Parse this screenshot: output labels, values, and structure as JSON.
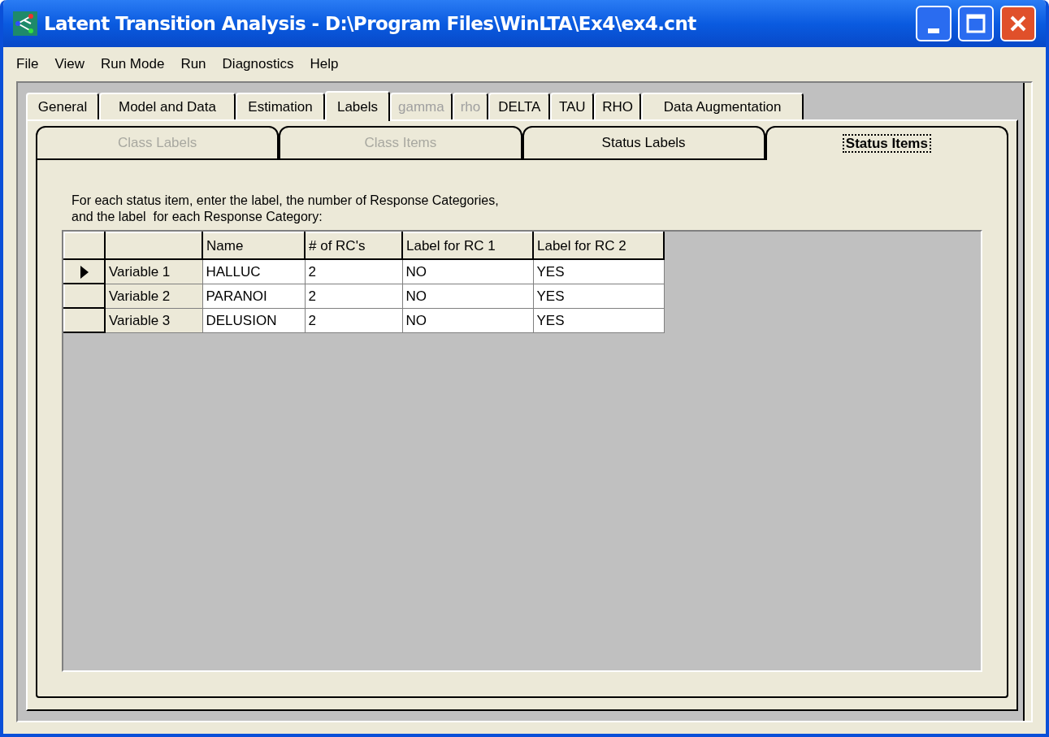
{
  "window": {
    "title": "Latent Transition Analysis - D:\\Program Files\\WinLTA\\Ex4\\ex4.cnt"
  },
  "menu": [
    "File",
    "View",
    "Run Mode",
    "Run",
    "Diagnostics",
    "Help"
  ],
  "tabs": [
    {
      "label": "General",
      "selected": false,
      "disabled": false
    },
    {
      "label": "Model and Data",
      "selected": false,
      "disabled": false
    },
    {
      "label": "Estimation",
      "selected": false,
      "disabled": false
    },
    {
      "label": "Labels",
      "selected": true,
      "disabled": false
    },
    {
      "label": "gamma",
      "selected": false,
      "disabled": true
    },
    {
      "label": "rho",
      "selected": false,
      "disabled": true
    },
    {
      "label": "DELTA",
      "selected": false,
      "disabled": false
    },
    {
      "label": "TAU",
      "selected": false,
      "disabled": false
    },
    {
      "label": "RHO",
      "selected": false,
      "disabled": false
    },
    {
      "label": "Data Augmentation",
      "selected": false,
      "disabled": false
    }
  ],
  "subtabs": [
    {
      "label": "Class Labels",
      "selected": false,
      "disabled": true
    },
    {
      "label": "Class Items",
      "selected": false,
      "disabled": true
    },
    {
      "label": "Status Labels",
      "selected": false,
      "disabled": false
    },
    {
      "label": "Status Items",
      "selected": true,
      "disabled": false
    }
  ],
  "instructions": [
    "For each status item, enter the label, the number of Response Categories,",
    "and the label  for each Response Category:"
  ],
  "table": {
    "columns": [
      "",
      "Name",
      "# of RC's",
      "Label for RC 1",
      "Label for RC 2"
    ],
    "rows": [
      {
        "selected": true,
        "cells": [
          "Variable 1",
          "HALLUC",
          "2",
          "NO",
          "YES"
        ]
      },
      {
        "selected": false,
        "cells": [
          "Variable 2",
          "PARANOI",
          "2",
          "NO",
          "YES"
        ]
      },
      {
        "selected": false,
        "cells": [
          "Variable 3",
          "DELUSION",
          "2",
          "NO",
          "YES"
        ]
      }
    ]
  }
}
